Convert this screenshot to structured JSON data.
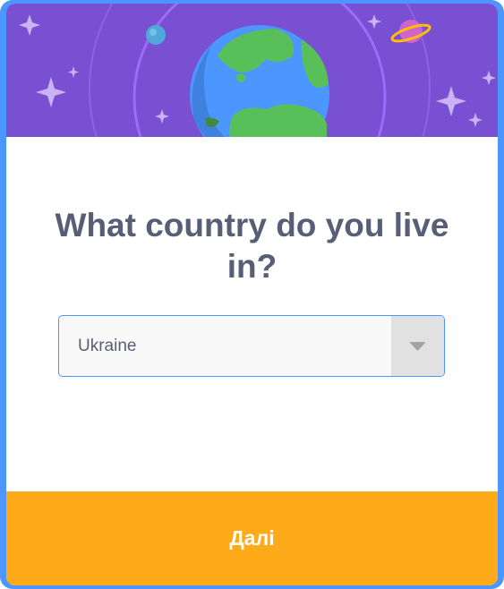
{
  "dialog": {
    "question": "What country do you live in?",
    "country_select": {
      "selected_value": "Ukraine"
    },
    "next_button_label": "Далі"
  },
  "colors": {
    "frame": "#4c97ff",
    "header_background": "#7950d1",
    "question_text": "#575e75",
    "select_border": "#4c97ff",
    "button_background": "#ffab19",
    "button_text": "#ffffff"
  },
  "icons": {
    "header_illustration": "earth-with-orbit-and-stars",
    "select_arrow": "caret-down-icon"
  }
}
